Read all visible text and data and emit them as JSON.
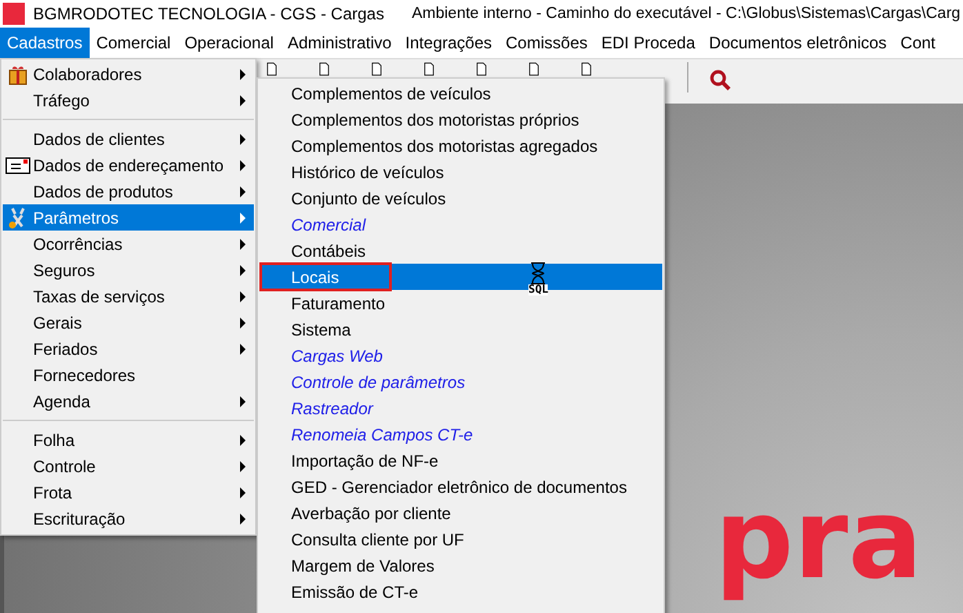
{
  "window": {
    "title": "BGMRODOTEC TECNOLOGIA - CGS - Cargas",
    "subtitle": "Ambiente interno - Caminho do executável - C:\\Globus\\Sistemas\\Cargas\\Carg"
  },
  "menubar": [
    {
      "label": "Cadastros",
      "selected": true
    },
    {
      "label": "Comercial",
      "selected": false
    },
    {
      "label": "Operacional",
      "selected": false
    },
    {
      "label": "Administrativo",
      "selected": false
    },
    {
      "label": "Integrações",
      "selected": false
    },
    {
      "label": "Comissões",
      "selected": false
    },
    {
      "label": "EDI Proceda",
      "selected": false
    },
    {
      "label": "Documentos eletrônicos",
      "selected": false
    },
    {
      "label": "Cont",
      "selected": false
    }
  ],
  "menu": [
    {
      "kind": "item",
      "label": "Colaboradores",
      "submenu": true,
      "selected": false
    },
    {
      "kind": "item",
      "label": "Tráfego",
      "submenu": true,
      "selected": false
    },
    {
      "kind": "separator"
    },
    {
      "kind": "item",
      "label": "Dados de clientes",
      "submenu": true,
      "selected": false
    },
    {
      "kind": "item",
      "label": "Dados de endereçamento",
      "submenu": true,
      "selected": false
    },
    {
      "kind": "item",
      "label": "Dados de produtos",
      "submenu": true,
      "selected": false
    },
    {
      "kind": "item",
      "label": "Parâmetros",
      "submenu": true,
      "selected": true
    },
    {
      "kind": "item",
      "label": "Ocorrências",
      "submenu": true,
      "selected": false
    },
    {
      "kind": "item",
      "label": "Seguros",
      "submenu": true,
      "selected": false
    },
    {
      "kind": "item",
      "label": "Taxas de serviços",
      "submenu": true,
      "selected": false
    },
    {
      "kind": "item",
      "label": "Gerais",
      "submenu": true,
      "selected": false
    },
    {
      "kind": "item",
      "label": "Feriados",
      "submenu": true,
      "selected": false
    },
    {
      "kind": "item",
      "label": "Fornecedores",
      "submenu": false,
      "selected": false
    },
    {
      "kind": "item",
      "label": "Agenda",
      "submenu": true,
      "selected": false
    },
    {
      "kind": "separator"
    },
    {
      "kind": "item",
      "label": "Folha",
      "submenu": true,
      "selected": false
    },
    {
      "kind": "item",
      "label": "Controle",
      "submenu": true,
      "selected": false
    },
    {
      "kind": "item",
      "label": "Frota",
      "submenu": true,
      "selected": false
    },
    {
      "kind": "item",
      "label": "Escrituração",
      "submenu": true,
      "selected": false
    }
  ],
  "submenu": [
    {
      "kind": "normal",
      "label": "Complementos de veículos",
      "selected": false
    },
    {
      "kind": "normal",
      "label": "Complementos dos motoristas próprios",
      "selected": false
    },
    {
      "kind": "normal",
      "label": "Complementos dos motoristas agregados",
      "selected": false
    },
    {
      "kind": "normal",
      "label": "Histórico de veículos",
      "selected": false
    },
    {
      "kind": "normal",
      "label": "Conjunto de veículos",
      "selected": false
    },
    {
      "kind": "italic",
      "label": "Comercial",
      "selected": false
    },
    {
      "kind": "normal",
      "label": "Contábeis",
      "selected": false
    },
    {
      "kind": "normal",
      "label": "Locais",
      "selected": true,
      "outlined": true
    },
    {
      "kind": "normal",
      "label": "Faturamento",
      "selected": false
    },
    {
      "kind": "normal",
      "label": "Sistema",
      "selected": false
    },
    {
      "kind": "italic",
      "label": "Cargas Web",
      "selected": false
    },
    {
      "kind": "italic",
      "label": "Controle de parâmetros",
      "selected": false
    },
    {
      "kind": "italic",
      "label": "Rastreador",
      "selected": false
    },
    {
      "kind": "italic",
      "label": "Renomeia Campos CT-e",
      "selected": false
    },
    {
      "kind": "normal",
      "label": "Importação de NF-e",
      "selected": false
    },
    {
      "kind": "normal",
      "label": "GED - Gerenciador eletrônico de documentos",
      "selected": false
    },
    {
      "kind": "normal",
      "label": "Averbação por cliente",
      "selected": false
    },
    {
      "kind": "normal",
      "label": "Consulta cliente por UF",
      "selected": false
    },
    {
      "kind": "normal",
      "label": "Margem de Valores",
      "selected": false
    },
    {
      "kind": "normal",
      "label": "Emissão de CT-e",
      "selected": false
    }
  ],
  "cursor": {
    "label": "SQL"
  },
  "logo": {
    "text": "pra"
  }
}
